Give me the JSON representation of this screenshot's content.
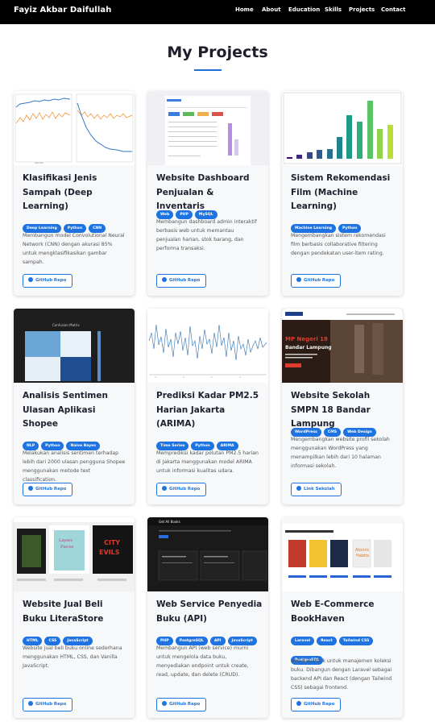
{
  "brand": "Fayiz Akbar Daifullah",
  "nav": [
    "Home",
    "About",
    "Education",
    "Skills",
    "Projects",
    "Contact"
  ],
  "section_title": "My Projects",
  "projects": [
    {
      "title": "Klasifikasi Jenis Sampah (Deep Learning)",
      "tags": [
        "Deep Learning",
        "Python",
        "CNN"
      ],
      "description": "Membangun model Convolutional Neural Network (CNN) dengan akurasi 85% untuk mengklasifikasikan gambar sampah.",
      "button": "GitHub Repo",
      "thumb": "training-loss-plots"
    },
    {
      "title": "Website Dashboard Penjualan & Inventaris",
      "tags": [
        "Web",
        "PHP",
        "MySQL"
      ],
      "description": "Membangun dashboard admin interaktif berbasis web untuk memantau penjualan harian, stok barang, dan performa transaksi.",
      "button": "GitHub Repo",
      "thumb": "dashboard-screenshot"
    },
    {
      "title": "Sistem Rekomendasi Film (Machine Learning)",
      "tags": [
        "Machine Learning",
        "Python"
      ],
      "description": "Mengembangkan sistem rekomendasi film berbasis collaborative filtering dengan pendekatan user-item rating.",
      "button": "GitHub Repo",
      "thumb": "bar-chart"
    },
    {
      "title": "Analisis Sentimen Ulasan Aplikasi Shopee",
      "tags": [
        "NLP",
        "Python",
        "Naive Bayes"
      ],
      "description": "Melakukan analisis sentimen terhadap lebih dari 2000 ulasan pengguna Shopee menggunakan metode text classification.",
      "button": "GitHub Repo",
      "thumb": "confusion-matrix"
    },
    {
      "title": "Prediksi Kadar PM2.5 Harian Jakarta (ARIMA)",
      "tags": [
        "Time Series",
        "Python",
        "ARIMA"
      ],
      "description": "Memprediksi kadar polutan PM2.5 harian di Jakarta menggunakan model ARIMA untuk informasi kualitas udara.",
      "button": "GitHub Repo",
      "thumb": "time-series-plot"
    },
    {
      "title": "Website Sekolah SMPN 18 Bandar Lampung",
      "tags": [
        "WordPress",
        "CMS",
        "Web Design"
      ],
      "description": "Mengembangkan website profil sekolah menggunakan WordPress yang menampilkan lebih dari 10 halaman informasi sekolah.",
      "button": "Link Sekolah",
      "thumb": "school-website"
    },
    {
      "title": "Website Jual Beli Buku LiteraStore",
      "tags": [
        "HTML",
        "CSS",
        "JavaScript"
      ],
      "description": "Website jual beli buku online sederhana menggunakan HTML, CSS, dan Vanilla JavaScript.",
      "button": "GitHub Repo",
      "thumb": "bookstore"
    },
    {
      "title": "Web Service Penyedia Buku (API)",
      "tags": [
        "PHP",
        "PostgreSQL",
        "API",
        "JavaScript"
      ],
      "description": "Membangun API (web service) murni untuk mengelola data buku, menyediakan endpoint untuk create, read, update, dan delete (CRUD).",
      "button": "GitHub Repo",
      "thumb": "api-dark"
    },
    {
      "title": "Web E-Commerce BookHaven",
      "tags": [
        "Laravel",
        "React",
        "Tailwind CSS",
        "PostgreSQL"
      ],
      "description": "web full-stack untuk manajemen koleksi buku. Dibangun dengan Laravel sebagai backend API dan React (dengan Tailwind CSS) sebagai frontend.",
      "button": "GitHub Repo",
      "thumb": "ecommerce"
    }
  ]
}
